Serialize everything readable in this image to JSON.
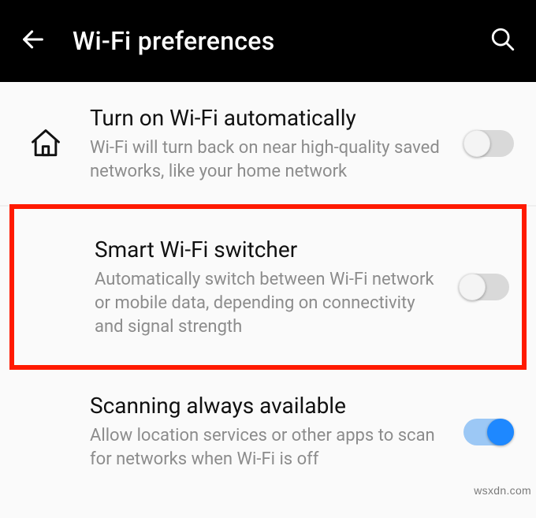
{
  "appbar": {
    "title": "Wi-Fi preferences"
  },
  "settings": {
    "auto_wifi": {
      "title": "Turn on Wi-Fi automatically",
      "subtitle": "Wi-Fi will turn back on near high-quality saved networks, like your home network",
      "enabled": false
    },
    "smart_switcher": {
      "title": "Smart Wi-Fi switcher",
      "subtitle": "Automatically switch between Wi-Fi network or mobile data, depending on connectivity and signal strength",
      "enabled": false
    },
    "scanning": {
      "title": "Scanning always available",
      "subtitle": "Allow location services or other apps to scan for networks when Wi-Fi is off",
      "enabled": true
    }
  },
  "watermark": "wsxdn.com",
  "colors": {
    "highlight": "#ff1a00",
    "toggle_on": "#1e88ff"
  }
}
